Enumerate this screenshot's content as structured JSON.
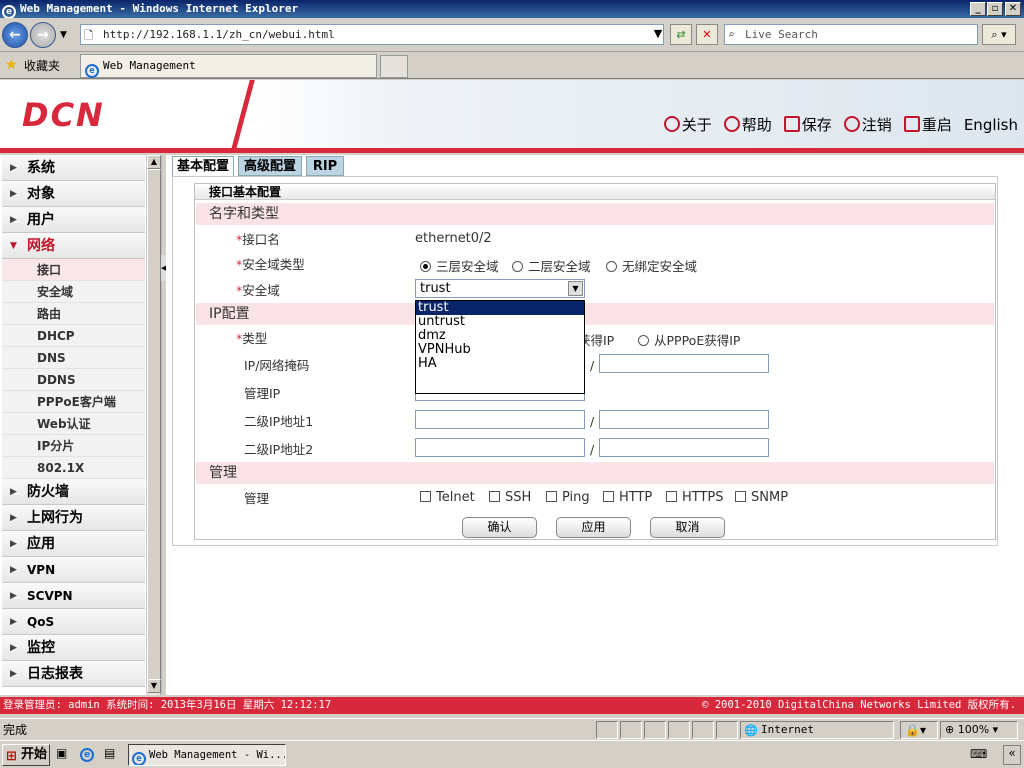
{
  "window": {
    "title": "Web Management - Windows Internet Explorer",
    "url": "http://192.168.1.1/zh_cn/webui.html",
    "search_placeholder": "Live Search",
    "favorites_label": "收藏夹",
    "tab_title": "Web Management"
  },
  "header": {
    "logo": "DCN",
    "links": [
      {
        "label": "关于",
        "icon": "info-icon"
      },
      {
        "label": "帮助",
        "icon": "help-icon"
      },
      {
        "label": "保存",
        "icon": "save-icon"
      },
      {
        "label": "注销",
        "icon": "logout-icon"
      },
      {
        "label": "重启",
        "icon": "reboot-icon"
      }
    ],
    "language": "English"
  },
  "sidebar": {
    "groups_top": [
      "系统",
      "对象",
      "用户"
    ],
    "network": "网络",
    "network_items": [
      "接口",
      "安全域",
      "路由",
      "DHCP",
      "DNS",
      "DDNS",
      "PPPoE客户端",
      "Web认证",
      "IP分片",
      "802.1X"
    ],
    "groups_bottom": [
      "防火墙",
      "上网行为",
      "应用",
      "VPN",
      "SCVPN",
      "QoS",
      "监控",
      "日志报表"
    ]
  },
  "tabs": [
    "基本配置",
    "高级配置",
    "RIP"
  ],
  "form": {
    "legend": "接口基本配置",
    "section_name": "名字和类型",
    "iface_label": "接口名",
    "iface_value": "ethernet0/2",
    "zone_type_label": "安全域类型",
    "zone_types": [
      "三层安全域",
      "二层安全域",
      "无绑定安全域"
    ],
    "zone_label": "安全域",
    "zone_value": "trust",
    "zone_options": [
      "trust",
      "untrust",
      "dmz",
      "VPNHub",
      "HA"
    ],
    "section_ip": "IP配置",
    "type_label": "类型",
    "type_option_partial": "获得IP",
    "type_option_pppoe": "从PPPoE获得IP",
    "ip_mask_label": "IP/网络掩码",
    "mgmt_ip_label": "管理IP",
    "sec_ip1_label": "二级IP地址1",
    "sec_ip2_label": "二级IP地址2",
    "slash": "/",
    "section_mgmt": "管理",
    "mgmt_label": "管理",
    "mgmt_options": [
      "Telnet",
      "SSH",
      "Ping",
      "HTTP",
      "HTTPS",
      "SNMP"
    ],
    "ok_button": "确认",
    "apply_button": "应用",
    "cancel_button": "取消"
  },
  "footer": {
    "left": "登录管理员: admin 系统时间: 2013年3月16日 星期六 12:12:17",
    "right": "© 2001-2010 DigitalChina Networks Limited 版权所有."
  },
  "statusbar": {
    "status": "完成",
    "zone": "Internet",
    "zoom": "100%"
  },
  "taskbar": {
    "start": "开始",
    "item": "Web Management - Wi..."
  },
  "colors": {
    "brand": "#d8283c",
    "selection": "#0a246a"
  }
}
